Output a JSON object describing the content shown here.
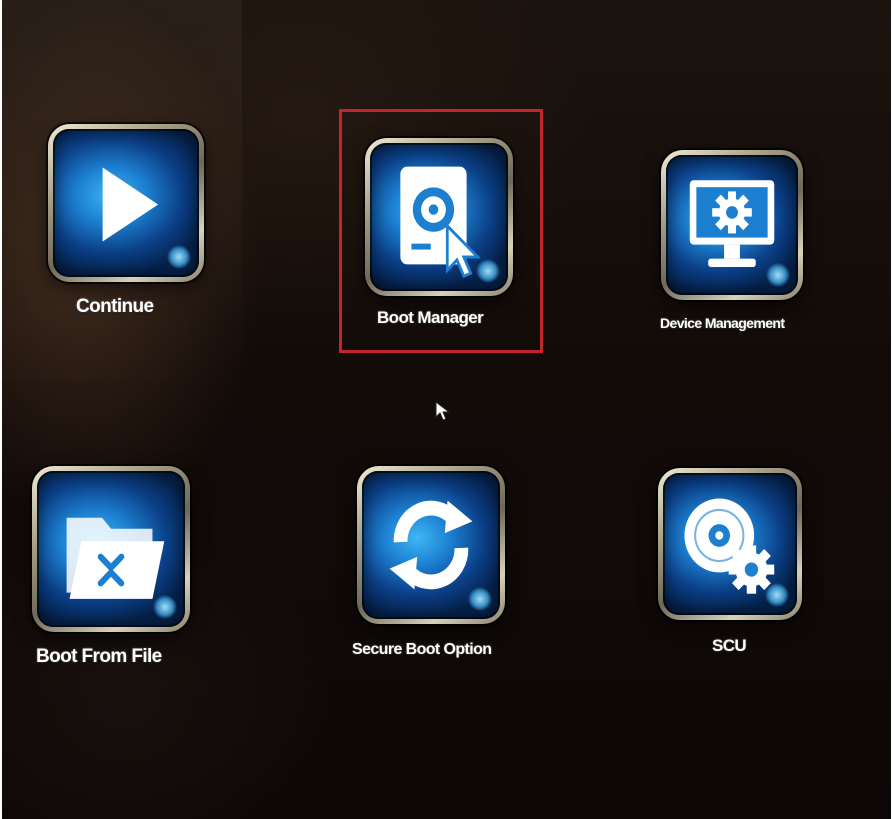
{
  "menu": {
    "items": [
      {
        "label": "Continue",
        "icon": "play-icon"
      },
      {
        "label": "Boot Manager",
        "icon": "boot-disk-icon",
        "selected": true
      },
      {
        "label": "Device Management",
        "icon": "monitor-gear-icon"
      },
      {
        "label": "Boot From File",
        "icon": "folder-icon"
      },
      {
        "label": "Secure Boot Option",
        "icon": "refresh-arrows-icon"
      },
      {
        "label": "SCU",
        "icon": "disc-gear-icon"
      }
    ]
  },
  "colors": {
    "selection_border": "#c1262d",
    "icon_blue": "#1c7fd0",
    "label_text": "#ffffff",
    "background": "#120b08"
  }
}
